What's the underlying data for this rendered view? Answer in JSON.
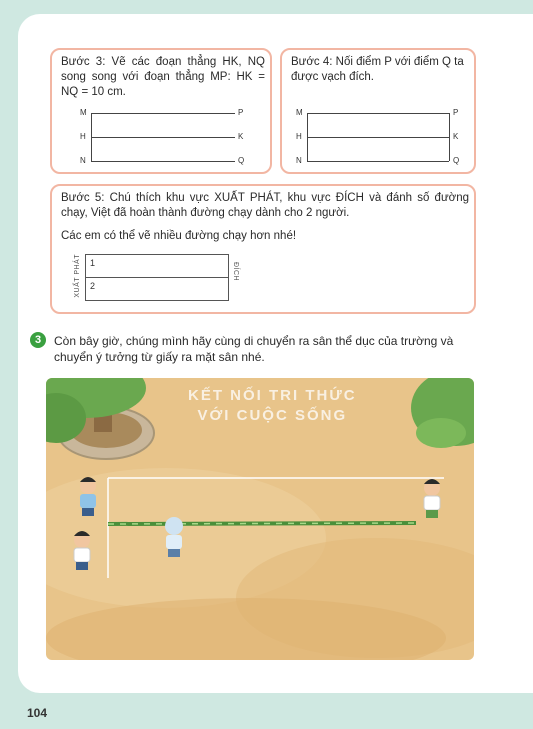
{
  "step3": {
    "text": "Bước 3: Vẽ các đoạn thẳng HK, NQ song song với đoạn thẳng MP: HK = NQ = 10 cm.",
    "points_left": [
      "M",
      "H",
      "N"
    ],
    "points_right": [
      "P",
      "K",
      "Q"
    ]
  },
  "step4": {
    "text": "Bước 4: Nối điểm P với điểm Q ta được vạch đích.",
    "points_left": [
      "M",
      "H",
      "N"
    ],
    "points_right": [
      "P",
      "K",
      "Q"
    ]
  },
  "step5": {
    "text": "Bước 5: Chú thích khu vực XUẤT PHÁT, khu vực ĐÍCH và đánh số đường chạy, Việt đã hoàn thành đường chạy dành cho 2 người.",
    "note": "Các em có thể vẽ nhiều đường chạy hơn nhé!",
    "start_label": "XUẤT PHÁT",
    "finish_label": "ĐÍCH",
    "lanes": [
      "1",
      "2"
    ]
  },
  "section3": {
    "number": "3",
    "text": "Còn bây giờ, chúng mình hãy cùng di chuyển ra sân thể dục của trường và chuyển ý tưởng từ giấy ra mặt sân nhé."
  },
  "watermark": {
    "line1": "KẾT NỐI TRI THỨC",
    "line2": "VỚI CUỘC SỐNG"
  },
  "page_number": "104"
}
